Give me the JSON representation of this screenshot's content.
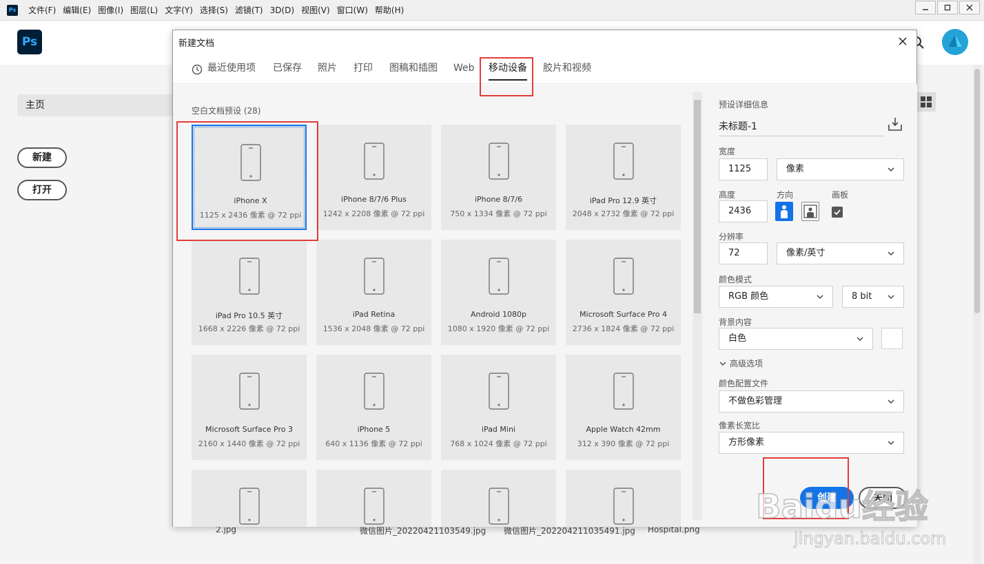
{
  "app": {
    "logo_text": "Ps",
    "menu": [
      "文件(F)",
      "编辑(E)",
      "图像(I)",
      "图层(L)",
      "文字(Y)",
      "选择(S)",
      "滤镜(T)",
      "3D(D)",
      "视图(V)",
      "窗口(W)",
      "帮助(H)"
    ],
    "home_label": "主页",
    "new_label": "新建",
    "open_label": "打开",
    "recent_files": [
      "2.jpg",
      "微信图片_20220421103549.jpg",
      "微信图片_202204211035491.jpg",
      "Hospital.png"
    ]
  },
  "dialog": {
    "title": "新建文档",
    "tabs": [
      "最近使用项",
      "已保存",
      "照片",
      "打印",
      "图稿和插图",
      "Web",
      "移动设备",
      "胶片和视频"
    ],
    "active_tab": "移动设备",
    "section_title": "空白文档预设",
    "section_count": "(28)",
    "presets": [
      {
        "name": "iPhone X",
        "dims": "1125 x 2436 像素 @ 72 ppi",
        "selected": true
      },
      {
        "name": "iPhone 8/7/6 Plus",
        "dims": "1242 x 2208 像素 @ 72 ppi"
      },
      {
        "name": "iPhone 8/7/6",
        "dims": "750 x 1334 像素 @ 72 ppi"
      },
      {
        "name": "iPad Pro 12.9 英寸",
        "dims": "2048 x 2732 像素 @ 72 ppi"
      },
      {
        "name": "iPad Pro 10.5 英寸",
        "dims": "1668 x 2226 像素 @ 72 ppi"
      },
      {
        "name": "iPad Retina",
        "dims": "1536 x 2048 像素 @ 72 ppi"
      },
      {
        "name": "Android 1080p",
        "dims": "1080 x 1920 像素 @ 72 ppi"
      },
      {
        "name": "Microsoft Surface Pro 4",
        "dims": "2736 x 1824 像素 @ 72 ppi"
      },
      {
        "name": "Microsoft Surface Pro 3",
        "dims": "2160 x 1440 像素 @ 72 ppi"
      },
      {
        "name": "iPhone 5",
        "dims": "640 x 1136 像素 @ 72 ppi"
      },
      {
        "name": "iPad Mini",
        "dims": "768 x 1024 像素 @ 72 ppi"
      },
      {
        "name": "Apple Watch 42mm",
        "dims": "312 x 390 像素 @ 72 ppi"
      }
    ],
    "details": {
      "heading": "预设详细信息",
      "doc_name": "未标题-1",
      "width_label": "宽度",
      "width_value": "1125",
      "width_unit": "像素",
      "height_label": "高度",
      "height_value": "2436",
      "orientation_label": "方向",
      "artboard_label": "画板",
      "resolution_label": "分辨率",
      "resolution_value": "72",
      "resolution_unit": "像素/英寸",
      "color_mode_label": "颜色模式",
      "color_mode": "RGB 颜色",
      "bit_depth": "8 bit",
      "background_label": "背景内容",
      "background": "白色",
      "advanced_label": "高级选项",
      "profile_label": "颜色配置文件",
      "profile": "不做色彩管理",
      "pixel_aspect_label": "像素长宽比",
      "pixel_aspect": "方形像素",
      "create_label": "创建",
      "close_label": "关闭"
    }
  },
  "colors": {
    "accent": "#1473e6",
    "annotation": "#e33b3b",
    "ps_dark": "#001e36",
    "ps_blue": "#31a8ff"
  },
  "watermark": {
    "brand": "Baidu经验",
    "url": "jingyan.baidu.com"
  }
}
